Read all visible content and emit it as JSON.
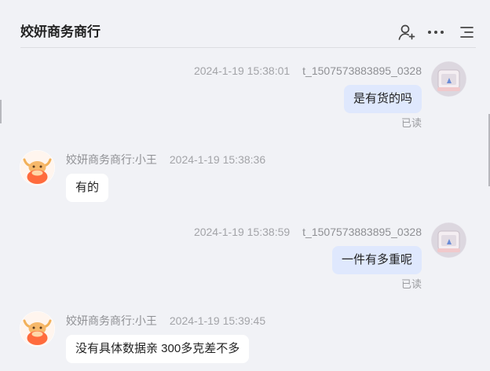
{
  "header": {
    "title": "姣妍商务商行",
    "icons": {
      "user": "add-user-icon",
      "more": "more-icon",
      "menu": "menu-icon"
    }
  },
  "messages": [
    {
      "direction": "out",
      "time": "2024-1-19 15:38:01",
      "sender": "t_1507573883895_0328",
      "text": "是有货的吗",
      "status": "已读"
    },
    {
      "direction": "in",
      "sender": "姣妍商务商行:小王",
      "time": "2024-1-19 15:38:36",
      "text": "有的"
    },
    {
      "direction": "out",
      "time": "2024-1-19 15:38:59",
      "sender": "t_1507573883895_0328",
      "text": "一件有多重呢",
      "status": "已读"
    },
    {
      "direction": "in",
      "sender": "姣妍商务商行:小王",
      "time": "2024-1-19 15:39:45",
      "text": "没有具体数据亲 300多克差不多"
    }
  ],
  "colors": {
    "background": "#f1f2f6",
    "my_bubble": "#dfe8fd",
    "their_bubble": "#ffffff",
    "seller_avatar": "#ff6b3d"
  }
}
